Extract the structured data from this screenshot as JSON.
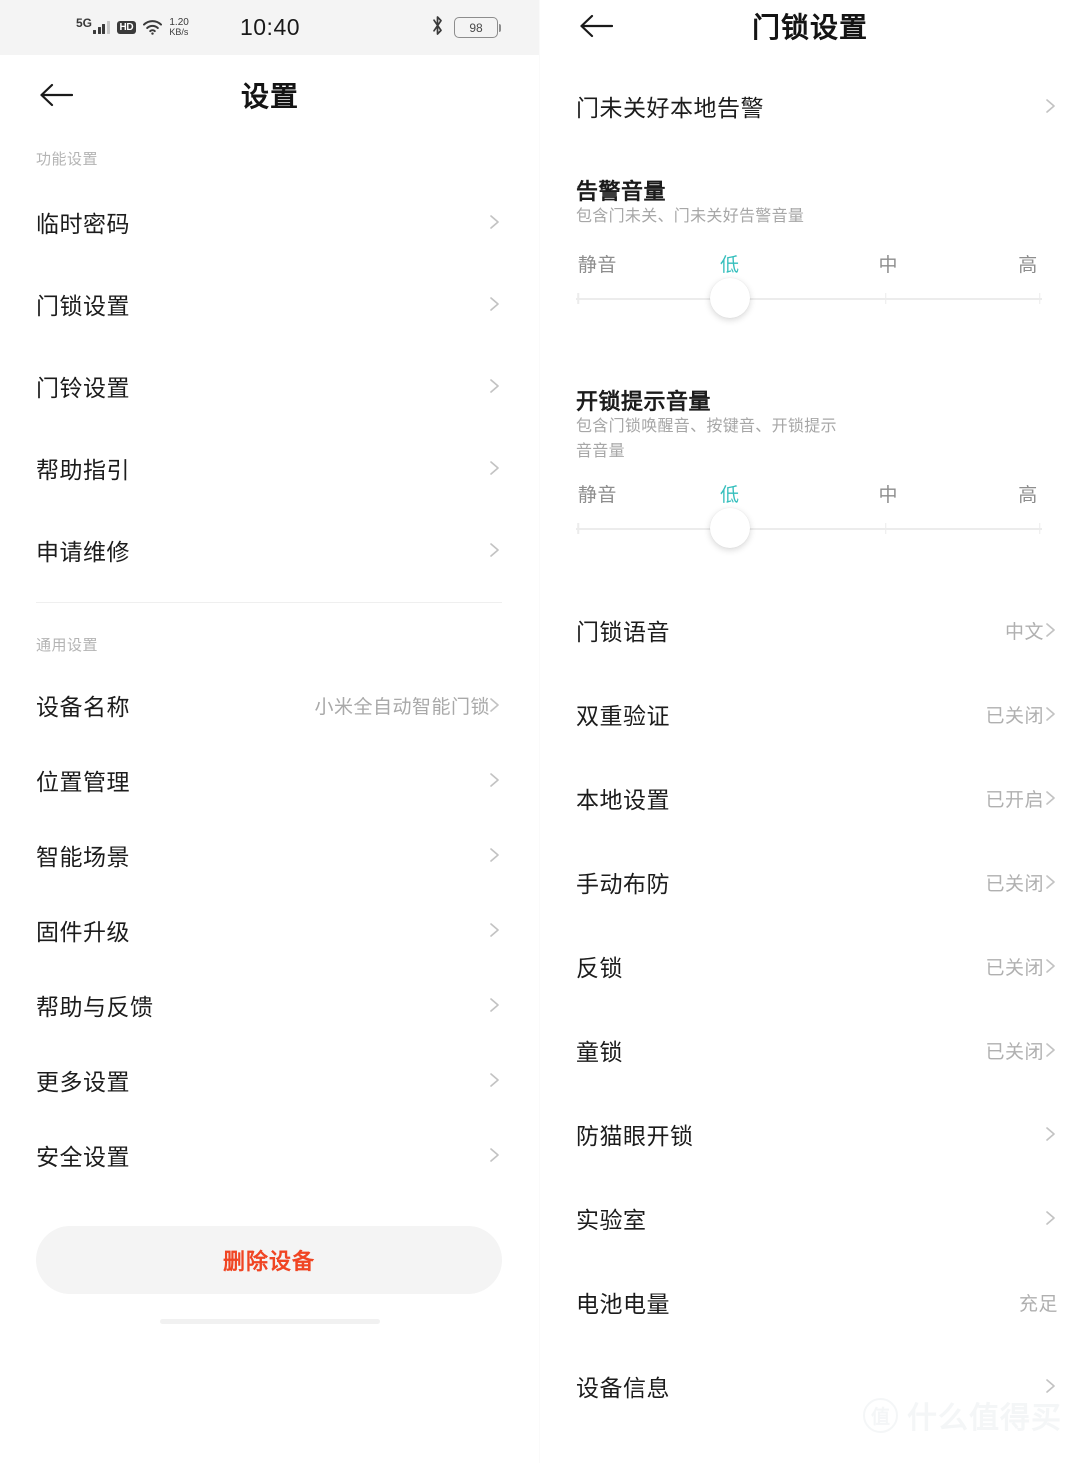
{
  "status_bar": {
    "network_type": "5G",
    "hd_badge": "HD",
    "net_speed_value": "1.20",
    "net_speed_unit": "KB/s",
    "time": "10:40",
    "battery_percent": "98",
    "icons": [
      "signal-bars-icon",
      "hd-icon",
      "wifi-icon",
      "bluetooth-icon",
      "battery-icon"
    ]
  },
  "left_panel": {
    "title": "设置",
    "back_icon": "arrow-left-icon",
    "sections": [
      {
        "label": "功能设置",
        "items": [
          {
            "label": "临时密码",
            "value": ""
          },
          {
            "label": "门锁设置",
            "value": ""
          },
          {
            "label": "门铃设置",
            "value": ""
          },
          {
            "label": "帮助指引",
            "value": ""
          },
          {
            "label": "申请维修",
            "value": ""
          }
        ]
      },
      {
        "label": "通用设置",
        "items": [
          {
            "label": "设备名称",
            "value": "小米全自动智能门锁"
          },
          {
            "label": "位置管理",
            "value": ""
          },
          {
            "label": "智能场景",
            "value": ""
          },
          {
            "label": "固件升级",
            "value": ""
          },
          {
            "label": "帮助与反馈",
            "value": ""
          },
          {
            "label": "更多设置",
            "value": ""
          },
          {
            "label": "安全设置",
            "value": ""
          }
        ]
      }
    ],
    "delete_button": {
      "label": "删除设备",
      "color": "#f04523"
    }
  },
  "right_panel": {
    "title": "门锁设置",
    "back_icon": "arrow-left-icon",
    "top_item": {
      "label": "门未关好本地告警"
    },
    "volume_controls": [
      {
        "title": "告警音量",
        "subtitle": "包含门未关、门未关好告警音量",
        "labels": [
          "静音",
          "低",
          "中",
          "高"
        ],
        "selected_index": 1,
        "selected_label": "低",
        "accent": "#36bfbd"
      },
      {
        "title": "开锁提示音量",
        "subtitle": "包含门锁唤醒音、按键音、开锁提示\n音音量",
        "labels": [
          "静音",
          "低",
          "中",
          "高"
        ],
        "selected_index": 1,
        "selected_label": "低",
        "accent": "#36bfbd"
      }
    ],
    "items": [
      {
        "label": "门锁语音",
        "value": "中文",
        "chevron": true
      },
      {
        "label": "双重验证",
        "value": "已关闭",
        "chevron": true
      },
      {
        "label": "本地设置",
        "value": "已开启",
        "chevron": true
      },
      {
        "label": "手动布防",
        "value": "已关闭",
        "chevron": true
      },
      {
        "label": "反锁",
        "value": "已关闭",
        "chevron": true
      },
      {
        "label": "童锁",
        "value": "已关闭",
        "chevron": true
      },
      {
        "label": "防猫眼开锁",
        "value": "",
        "chevron": true
      },
      {
        "label": "实验室",
        "value": "",
        "chevron": true
      },
      {
        "label": "电池电量",
        "value": "充足",
        "chevron": false
      },
      {
        "label": "设备信息",
        "value": "",
        "chevron": true
      }
    ]
  },
  "watermark": {
    "mark": "值",
    "text": "什么值得买"
  }
}
